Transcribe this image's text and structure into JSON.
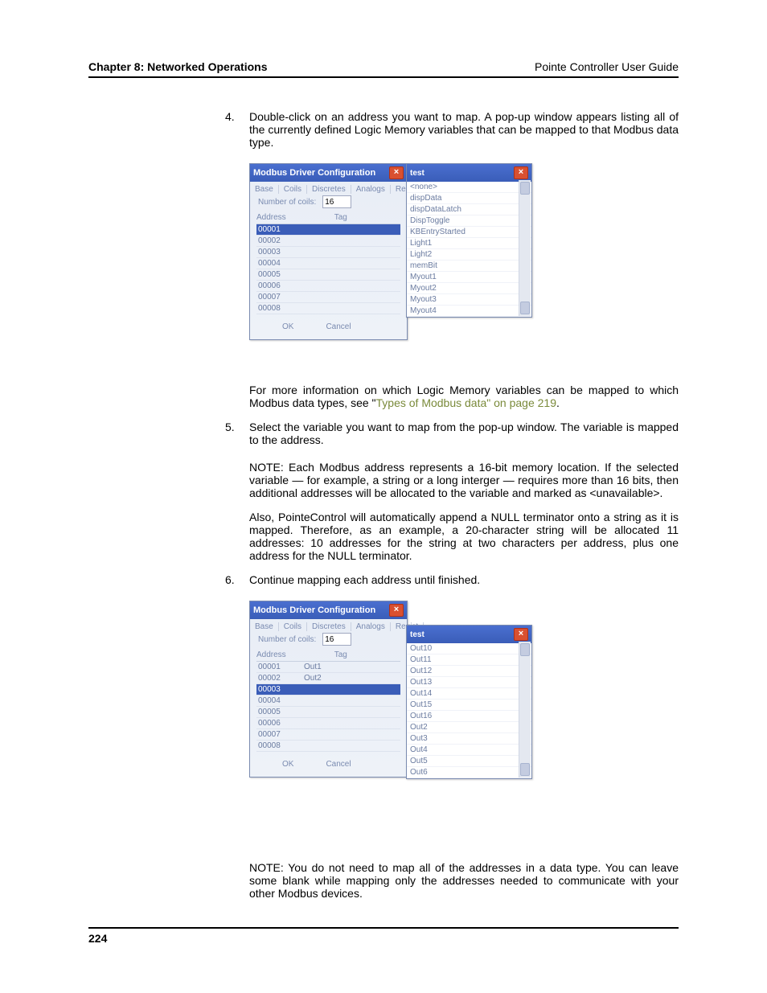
{
  "header": {
    "left": "Chapter 8: Networked Operations",
    "right": "Pointe Controller User Guide"
  },
  "page_number": "224",
  "step4": {
    "num": "4.",
    "text": "Double-click on an address you want to map. A pop-up window appears listing all of the currently defined Logic Memory variables that can be mapped to that Modbus data type."
  },
  "fig1": {
    "title": "Modbus Driver Configuration",
    "tabs": [
      "Base",
      "Coils",
      "Discretes",
      "Analogs",
      "Registe"
    ],
    "coils_label": "Number of coils:",
    "coils_value": "16",
    "col1": "Address",
    "col2": "Tag",
    "rows": [
      {
        "addr": "00001",
        "tag": "",
        "sel": true
      },
      {
        "addr": "00002",
        "tag": ""
      },
      {
        "addr": "00003",
        "tag": ""
      },
      {
        "addr": "00004",
        "tag": ""
      },
      {
        "addr": "00005",
        "tag": ""
      },
      {
        "addr": "00006",
        "tag": ""
      },
      {
        "addr": "00007",
        "tag": ""
      },
      {
        "addr": "00008",
        "tag": ""
      }
    ],
    "ok": "OK",
    "cancel": "Cancel",
    "popup_title": "test",
    "popup_items": [
      "<none>",
      "dispData",
      "dispDataLatch",
      "DispToggle",
      "KBEntryStarted",
      "Light1",
      "Light2",
      "memBit",
      "Myout1",
      "Myout2",
      "Myout3",
      "Myout4"
    ]
  },
  "para_after4a": "For more information on which Logic Memory variables can be mapped to which Modbus data types, see \"",
  "xref4": "Types of Modbus data\" on page 219",
  "para_after4b": ".",
  "step5": {
    "num": "5.",
    "text": "Select the variable you want to map from the pop-up window. The variable is mapped to the address."
  },
  "note5a": "NOTE: Each Modbus address represents a 16-bit memory location. If the selected variable — for example, a string or a long interger — requires more than 16 bits, then additional addresses will be allocated to the variable and marked as <unavailable>.",
  "note5b": "Also, PointeControl will automatically append a NULL terminator onto a string as it is mapped. Therefore, as an example, a 20-character string will be allocated 11 addresses: 10 addresses for the string at two characters per address, plus one address for the NULL terminator.",
  "step6": {
    "num": "6.",
    "text": "Continue mapping each address until finished."
  },
  "fig2": {
    "title": "Modbus Driver Configuration",
    "tabs": [
      "Base",
      "Coils",
      "Discretes",
      "Analogs",
      "Regist"
    ],
    "coils_label": "Number of coils:",
    "coils_value": "16",
    "col1": "Address",
    "col2": "Tag",
    "rows": [
      {
        "addr": "00001",
        "tag": "Out1"
      },
      {
        "addr": "00002",
        "tag": "Out2"
      },
      {
        "addr": "00003",
        "tag": "",
        "sel": true
      },
      {
        "addr": "00004",
        "tag": ""
      },
      {
        "addr": "00005",
        "tag": ""
      },
      {
        "addr": "00006",
        "tag": ""
      },
      {
        "addr": "00007",
        "tag": ""
      },
      {
        "addr": "00008",
        "tag": ""
      }
    ],
    "ok": "OK",
    "cancel": "Cancel",
    "popup_title": "test",
    "popup_items": [
      "Out10",
      "Out11",
      "Out12",
      "Out13",
      "Out14",
      "Out15",
      "Out16",
      "Out2",
      "Out3",
      "Out4",
      "Out5",
      "Out6"
    ]
  },
  "note_final": "NOTE: You do not need to map all of the addresses in a data type. You can leave some blank while mapping only the addresses needed to communicate with your other Modbus devices."
}
